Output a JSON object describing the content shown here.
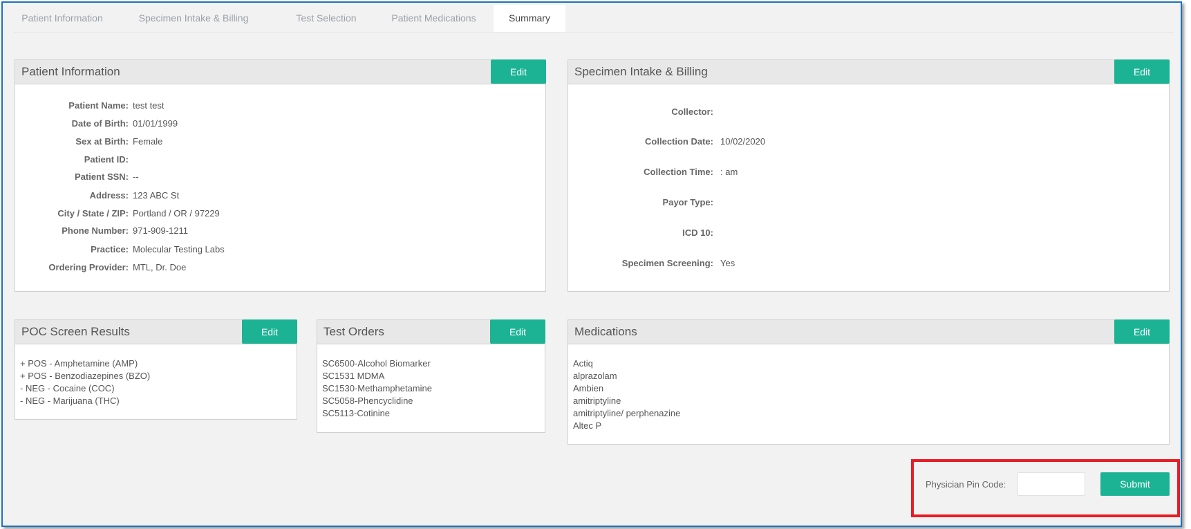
{
  "tabs": [
    {
      "label": "Patient Information"
    },
    {
      "label": "Specimen Intake & Billing"
    },
    {
      "label": "Test Selection"
    },
    {
      "label": "Patient Medications"
    },
    {
      "label": "Summary",
      "active": true
    }
  ],
  "edit_label": "Edit",
  "patient_info": {
    "title": "Patient Information",
    "fields": [
      {
        "label": "Patient Name:",
        "value": "test test"
      },
      {
        "label": "Date of Birth:",
        "value": "01/01/1999"
      },
      {
        "label": "Sex at Birth:",
        "value": "Female"
      },
      {
        "label": "Patient ID:",
        "value": ""
      },
      {
        "label": "Patient SSN:",
        "value": "--"
      },
      {
        "label": "Address:",
        "value": "123 ABC St"
      },
      {
        "label": "City / State / ZIP:",
        "value": "Portland / OR / 97229"
      },
      {
        "label": "Phone Number:",
        "value": "971-909-1211"
      },
      {
        "label": "Practice:",
        "value": "Molecular Testing Labs"
      },
      {
        "label": "Ordering Provider:",
        "value": "MTL, Dr. Doe"
      }
    ]
  },
  "specimen": {
    "title": "Specimen Intake & Billing",
    "fields": [
      {
        "label": "Collector:",
        "value": ""
      },
      {
        "label": "Collection Date:",
        "value": "10/02/2020"
      },
      {
        "label": "Collection Time:",
        "value": ": am"
      },
      {
        "label": "Payor Type:",
        "value": ""
      },
      {
        "label": "ICD 10:",
        "value": ""
      },
      {
        "label": "Specimen Screening:",
        "value": "Yes"
      }
    ]
  },
  "poc": {
    "title": "POC Screen Results",
    "items": [
      "+ POS - Amphetamine (AMP)",
      "+ POS - Benzodiazepines (BZO)",
      "- NEG - Cocaine (COC)",
      "- NEG - Marijuana (THC)"
    ]
  },
  "test_orders": {
    "title": "Test Orders",
    "items": [
      "SC6500-Alcohol Biomarker",
      "SC1531 MDMA",
      "SC1530-Methamphetamine",
      "SC5058-Phencyclidine",
      "SC5113-Cotinine"
    ]
  },
  "medications": {
    "title": "Medications",
    "items": [
      "Actiq",
      "alprazolam",
      "Ambien",
      "amitriptyline",
      "amitriptyline/ perphenazine",
      "Altec P"
    ]
  },
  "footer": {
    "pin_label": "Physician Pin Code:",
    "pin_value": "",
    "submit_label": "Submit"
  },
  "colors": {
    "accent": "#1cb394",
    "highlight": "#e81c24",
    "frame": "#1a72bd"
  }
}
